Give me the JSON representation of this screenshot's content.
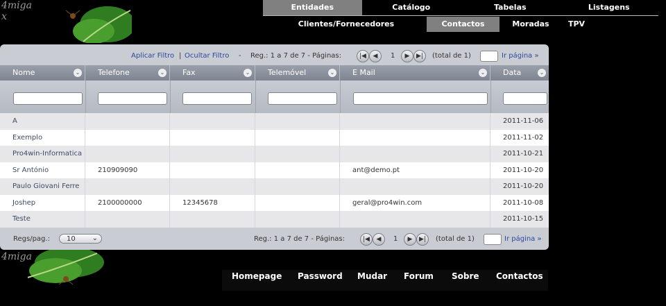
{
  "brand": {
    "text_top": "4miga",
    "text_mid": "x",
    "text_bottom": "4miga"
  },
  "topnav": [
    "Entidades",
    "Catálogo",
    "Tabelas",
    "Listagens"
  ],
  "subnav": [
    "Clientes/Fornecedores",
    "Contactos",
    "Moradas",
    "TPV"
  ],
  "pager": {
    "apply_filter": "Aplicar Filtro",
    "sep": "|",
    "hide_filter": "Ocultar Filtro",
    "dash": "-",
    "reg": "Reg.: 1 a 7 de 7 - Páginas:",
    "page": "1",
    "total": "(total de 1)",
    "goto": "Ir página »",
    "first_icon": "|◀",
    "prev_icon": "◀",
    "next_icon": "▶",
    "last_icon": "▶|"
  },
  "columns": [
    "Nome",
    "Telefone",
    "Fax",
    "Telemóvel",
    "E Mail",
    "Data"
  ],
  "rows": [
    [
      "A",
      "",
      "",
      "",
      "",
      "2011-11-06"
    ],
    [
      "Exemplo",
      "",
      "",
      "",
      "",
      "2011-11-02"
    ],
    [
      "Pro4win-Informatica",
      "",
      "",
      "",
      "",
      "2011-10-21"
    ],
    [
      "Sr António",
      "210909090",
      "",
      "",
      "ant@demo.pt",
      "2011-10-20"
    ],
    [
      "Paulo Giovani Ferre",
      "",
      "",
      "",
      "",
      "2011-10-20"
    ],
    [
      "Joshep",
      "2100000000",
      "12345678",
      "",
      "geral@pro4win.com",
      "2011-10-08"
    ],
    [
      "Teste",
      "",
      "",
      "",
      "",
      "2011-10-15"
    ]
  ],
  "bottom": {
    "per_page_label": "Regs/pag.:",
    "per_page_value": "10"
  },
  "footer": [
    "Homepage",
    "Password",
    "Mudar",
    "Forum",
    "Sobre",
    "Contactos"
  ]
}
